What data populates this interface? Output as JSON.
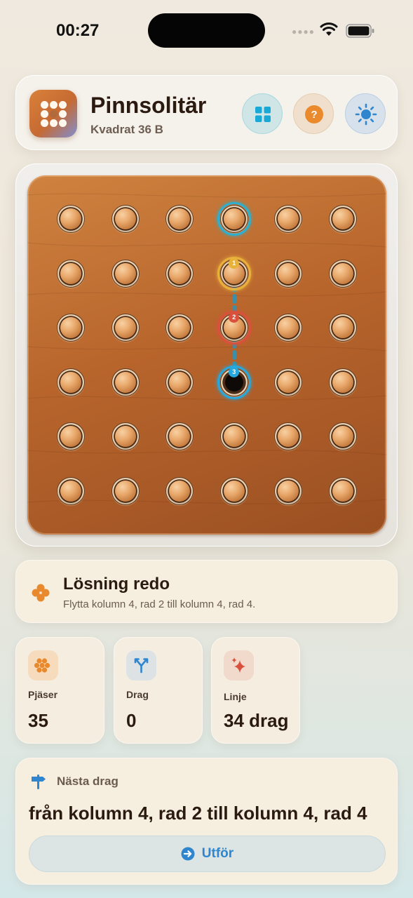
{
  "status_bar": {
    "time": "00:27"
  },
  "header": {
    "title": "Pinnsolitär",
    "subtitle": "Kvadrat 36 B",
    "buttons": {
      "grid": "grid-icon",
      "help": "help-icon",
      "theme": "sun-icon"
    }
  },
  "board": {
    "rows": 6,
    "cols": 6,
    "empty_holes": [
      [
        4,
        4
      ]
    ],
    "highlights": [
      {
        "col": 4,
        "row": 1,
        "color": "#2bb0d0"
      },
      {
        "col": 4,
        "row": 2,
        "color": "#e7b13a",
        "badge": "1"
      },
      {
        "col": 4,
        "row": 3,
        "color": "#d9513d",
        "badge": "2"
      },
      {
        "col": 4,
        "row": 4,
        "color": "#25a8dd",
        "badge": "3"
      }
    ]
  },
  "solution": {
    "title": "Lösning redo",
    "description": "Flytta kolumn 4, rad 2 till kolumn 4, rad 4."
  },
  "stats": [
    {
      "label": "Pjäser",
      "value": "35",
      "icon": "pegs-icon"
    },
    {
      "label": "Drag",
      "value": "0",
      "icon": "fork-icon"
    },
    {
      "label": "Linje",
      "value": "34 drag",
      "icon": "sparkle-icon"
    }
  ],
  "next_move": {
    "label": "Nästa drag",
    "text": "från kolumn 4, rad 2 till kolumn 4, rad 4",
    "button_label": "Utför"
  },
  "colors": {
    "accent": "#e9892d",
    "blue": "#2f86cf",
    "board": "#b8652c"
  }
}
